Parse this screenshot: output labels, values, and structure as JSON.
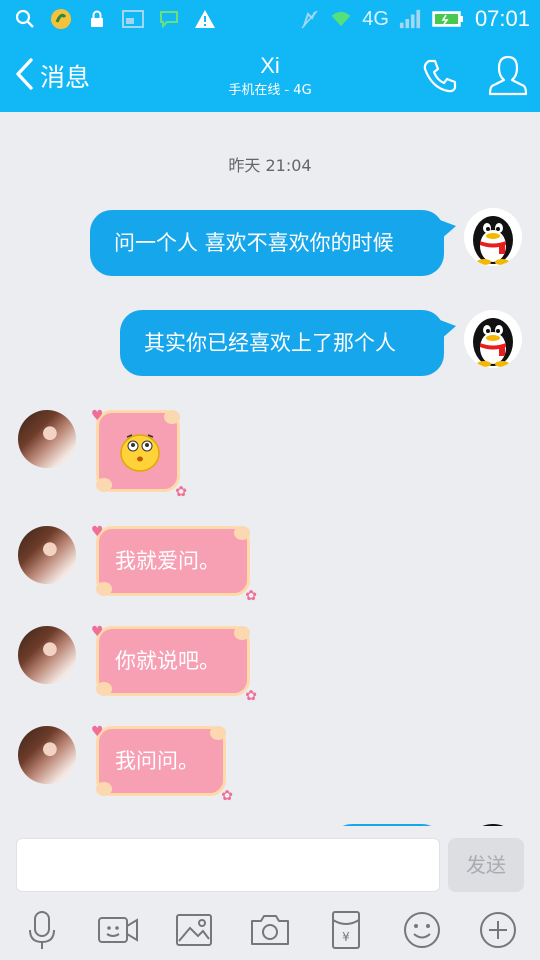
{
  "status_bar": {
    "network": "4G",
    "time": "07:01"
  },
  "header": {
    "back_label": "消息",
    "contact_name": "Xi",
    "contact_status": "手机在线 - 4G"
  },
  "chat": {
    "timestamp": "昨天 21:04",
    "outgoing": [
      {
        "text": "问一个人 喜欢不喜欢你的时候"
      },
      {
        "text": "其实你已经喜欢上了那个人"
      }
    ],
    "incoming": [
      {
        "text": "",
        "content": "emoji-confused-face"
      },
      {
        "text": "我就爱问。"
      },
      {
        "text": "你就说吧。"
      },
      {
        "text": "我问问。"
      }
    ]
  },
  "composer": {
    "input_value": "",
    "send_label": "发送"
  },
  "toolbar": {
    "icons": [
      "microphone-icon",
      "video-call-icon",
      "image-icon",
      "camera-icon",
      "red-packet-icon",
      "emoji-icon",
      "plus-icon"
    ]
  },
  "colors": {
    "accent": "#12b7f5",
    "outgoing_bubble": "#16a6ec",
    "incoming_bubble": "#f7a0b3",
    "background": "#ebedf0"
  }
}
